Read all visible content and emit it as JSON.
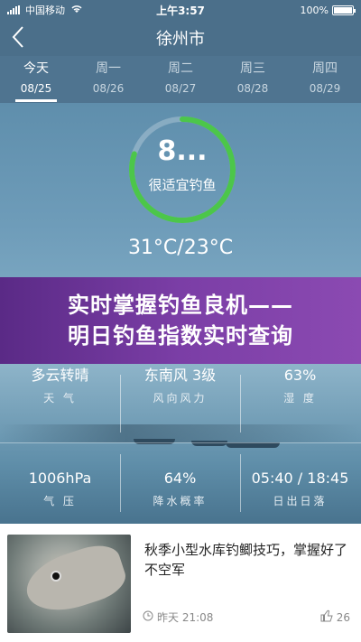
{
  "status": {
    "carrier": "中国移动",
    "time": "上午3:57",
    "battery": "100%",
    "battery_level": 1.0
  },
  "nav": {
    "city": "徐州市",
    "back_icon": "back-chevron-icon"
  },
  "days": [
    {
      "label": "今天",
      "date": "08/25",
      "active": true
    },
    {
      "label": "周一",
      "date": "08/26",
      "active": false
    },
    {
      "label": "周二",
      "date": "08/27",
      "active": false
    },
    {
      "label": "周三",
      "date": "08/28",
      "active": false
    },
    {
      "label": "周四",
      "date": "08/29",
      "active": false
    }
  ],
  "index": {
    "value": "8...",
    "label": "很适宜钓鱼",
    "ring_fraction": 0.8,
    "ring_color": "#4cc64a"
  },
  "temps": "31°C/23°C",
  "banner": {
    "line1": "实时掌握钓鱼良机——",
    "line2": "明日钓鱼指数实时查询"
  },
  "weather": [
    {
      "value": "多云转晴",
      "label": "天  气"
    },
    {
      "value": "东南风 3级",
      "label": "风向风力"
    },
    {
      "value": "63%",
      "label": "湿  度"
    },
    {
      "value": "1006hPa",
      "label": "气  压"
    },
    {
      "value": "64%",
      "label": "降水概率"
    },
    {
      "value": "05:40 / 18:45",
      "label": "日出日落"
    }
  ],
  "article": {
    "title": "秋季小型水库钓鲫技巧，掌握好了不空军",
    "time": "昨天 21:08",
    "likes": "26"
  }
}
